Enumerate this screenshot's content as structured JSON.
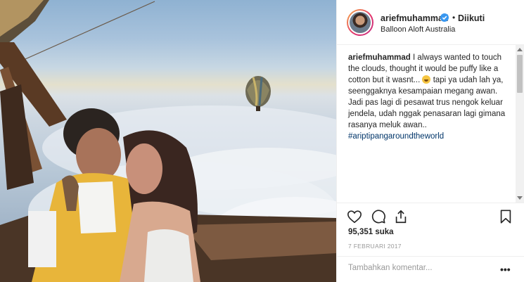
{
  "header": {
    "username": "ariefmuhammad",
    "separator": "•",
    "follow_status": "Diikuti",
    "location": "Balloon Aloft Australia",
    "verified": true
  },
  "caption": {
    "username": "ariefmuhammad",
    "text_before_emoji": "I always wanted to touch the clouds, thought it would be puffy like a cotton but it wasnt...",
    "emoji": "laughing-emoji",
    "text_after_emoji": "tapi ya udah lah ya, seenggaknya kesampaian megang awan. Jadi pas lagi di pesawat trus nengok keluar jendela, udah nggak penasaran lagi gimana rasanya meluk awan..",
    "hashtag": "#ariptipangaroundtheworld"
  },
  "actions": {
    "likes": "95,351 suka",
    "date": "7 FEBRUARI 2017"
  },
  "comment": {
    "placeholder": "Tambahkan komentar...",
    "more_label": "•••"
  },
  "colors": {
    "text": "#262626",
    "muted": "#999999",
    "hashtag": "#003569",
    "verified_blue": "#3897f0",
    "border": "#efefef"
  },
  "icons": [
    "verified-badge-icon",
    "heart-icon",
    "comment-bubble-icon",
    "share-upload-icon",
    "bookmark-icon",
    "more-options-icon"
  ]
}
